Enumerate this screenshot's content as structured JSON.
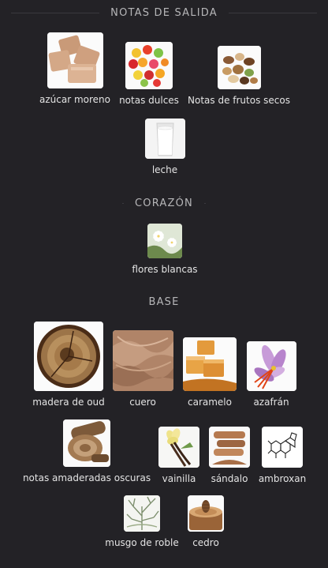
{
  "sections": {
    "top": {
      "title": "NOTAS DE SALIDA"
    },
    "heart": {
      "title": "CORAZÓN"
    },
    "base": {
      "title": "BASE"
    }
  },
  "notes": {
    "azucar_moreno": {
      "label": "azúcar moreno",
      "icon": "brown-sugar-image"
    },
    "notas_dulces": {
      "label": "notas dulces",
      "icon": "candy-image"
    },
    "frutos_secos": {
      "label": "Notas de frutos secos",
      "icon": "nuts-image"
    },
    "leche": {
      "label": "leche",
      "icon": "milk-glass-image"
    },
    "flores_blancas": {
      "label": "flores blancas",
      "icon": "white-flowers-image"
    },
    "madera_de_oud": {
      "label": "madera de oud",
      "icon": "oud-wood-image"
    },
    "cuero": {
      "label": "cuero",
      "icon": "leather-image"
    },
    "caramelo": {
      "label": "caramelo",
      "icon": "caramel-image"
    },
    "azafran": {
      "label": "azafrán",
      "icon": "saffron-image"
    },
    "amaderadas_oscuras": {
      "label": "notas amaderadas oscuras",
      "icon": "dark-wood-image"
    },
    "vainilla": {
      "label": "vainilla",
      "icon": "vanilla-image"
    },
    "sandalo": {
      "label": "sándalo",
      "icon": "sandalwood-image"
    },
    "ambroxan": {
      "label": "ambroxan",
      "icon": "molecule-image"
    },
    "musgo_de_roble": {
      "label": "musgo de roble",
      "icon": "oakmoss-image"
    },
    "cedro": {
      "label": "cedro",
      "icon": "cedar-image"
    }
  }
}
